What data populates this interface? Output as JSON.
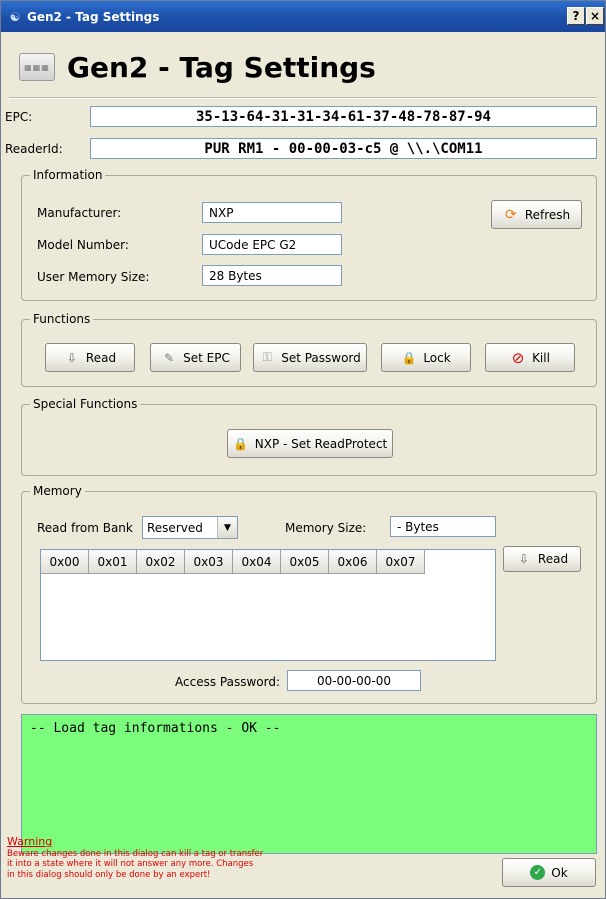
{
  "window": {
    "title": "Gen2 - Tag Settings",
    "help_button": "?",
    "close_button": "×"
  },
  "header": {
    "title": "Gen2 - Tag Settings"
  },
  "epc": {
    "label": "EPC:",
    "value": "35-13-64-31-31-34-61-37-48-78-87-94"
  },
  "reader": {
    "label": "ReaderId:",
    "value": "PUR RM1 - 00-00-03-c5 @ \\\\.\\COM11"
  },
  "information": {
    "title": "Information",
    "manufacturer_label": "Manufacturer:",
    "manufacturer_value": "NXP",
    "model_label": "Model Number:",
    "model_value": "UCode EPC G2",
    "memsize_label": "User Memory Size:",
    "memsize_value": "28 Bytes",
    "refresh_label": "Refresh"
  },
  "functions": {
    "title": "Functions",
    "read_label": "Read",
    "set_epc_label": "Set EPC",
    "set_password_label": "Set Password",
    "lock_label": "Lock",
    "kill_label": "Kill"
  },
  "special": {
    "title": "Special Functions",
    "nxp_label": "NXP - Set ReadProtect"
  },
  "memory": {
    "title": "Memory",
    "bank_label": "Read from Bank",
    "bank_value": "Reserved",
    "size_label": "Memory Size:",
    "size_value": "- Bytes",
    "read_label": "Read",
    "columns": [
      "0x00",
      "0x01",
      "0x02",
      "0x03",
      "0x04",
      "0x05",
      "0x06",
      "0x07"
    ],
    "password_label": "Access Password:",
    "password_value": "00-00-00-00"
  },
  "status": {
    "text": "-- Load tag informations - OK --",
    "color": "#7cfc7c"
  },
  "warning": {
    "title": "Warning",
    "line1": "Beware changes done in this dialog can kill a tag or transfer",
    "line2": "it into a state where it will not answer any more. Changes",
    "line3": "in this dialog should only be done by an expert!"
  },
  "ok_label": "Ok"
}
